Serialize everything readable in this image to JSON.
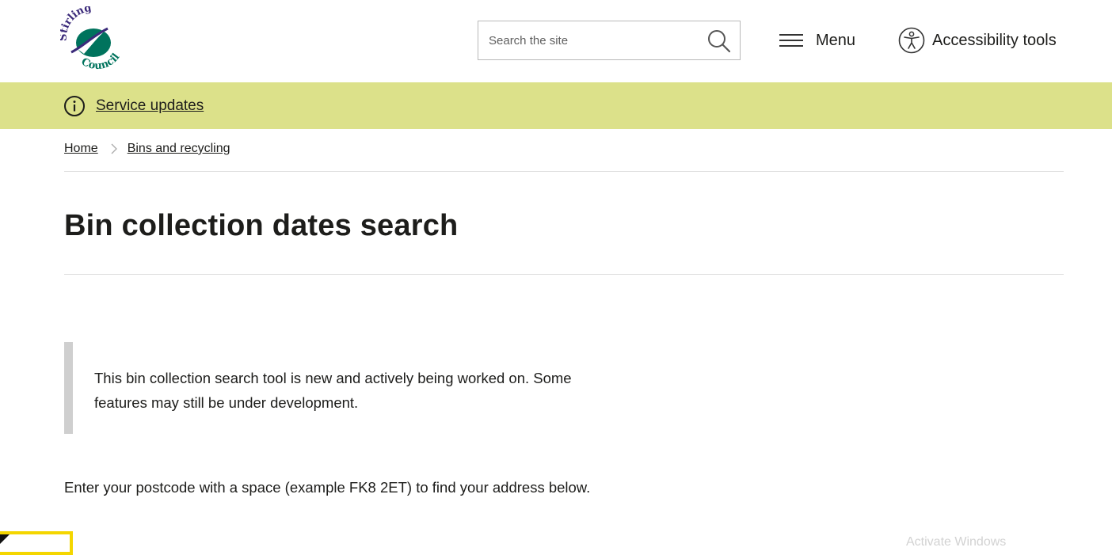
{
  "header": {
    "logo_text_top": "Stirling",
    "logo_text_bottom": "Council",
    "search": {
      "placeholder": "Search the site",
      "value": ""
    },
    "menu_label": "Menu",
    "accessibility_label": "Accessibility tools"
  },
  "service_bar": {
    "link_label": "Service updates"
  },
  "breadcrumb": {
    "items": [
      {
        "label": "Home"
      },
      {
        "label": "Bins and recycling"
      }
    ]
  },
  "page": {
    "title": "Bin collection dates search",
    "notice_text": "This bin collection search tool is new and actively being worked on. Some features may still be under development.",
    "instructions": "Enter your postcode with a space (example FK8 2ET) to find your address below."
  },
  "overlay": {
    "watermark_text": "Activate Windows"
  },
  "colors": {
    "service_bar": "#dce18a",
    "logo_green": "#00735d",
    "logo_purple": "#3b2a7a",
    "focus_yellow": "#f4d600",
    "notice_border": "#cfcfcf"
  },
  "icons": {
    "search": "search-icon",
    "menu": "hamburger-menu-icon",
    "accessibility": "accessibility-person-icon",
    "info": "info-circle-icon",
    "breadcrumb_separator": "chevron-right-icon"
  }
}
